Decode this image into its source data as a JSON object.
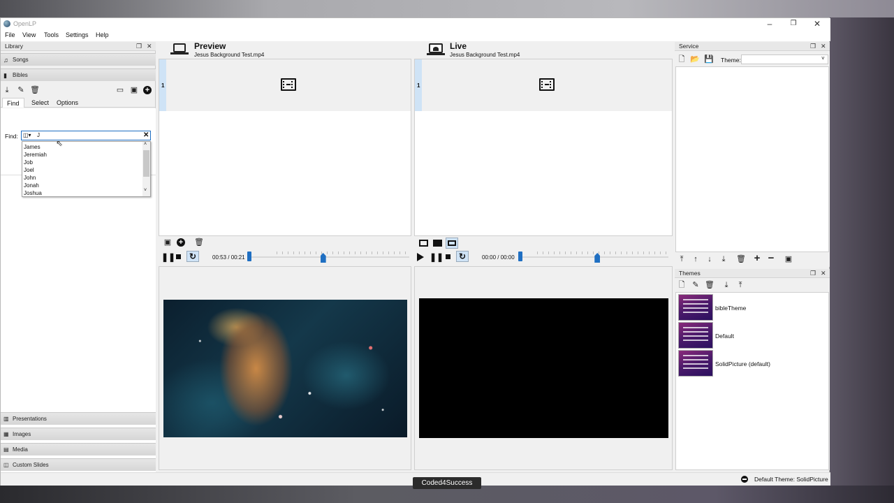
{
  "window": {
    "title": "OpenLP"
  },
  "menu": [
    "File",
    "View",
    "Tools",
    "Settings",
    "Help"
  ],
  "library": {
    "title": "Library",
    "items_top": [
      {
        "label": "Songs",
        "icon": "music-note-icon"
      },
      {
        "label": "Bibles",
        "icon": "book-icon"
      }
    ],
    "tabs": [
      "Find",
      "Select",
      "Options"
    ],
    "find_label": "Find:",
    "find_value": "J",
    "suggestions": [
      "James",
      "Jeremiah",
      "Job",
      "Joel",
      "John",
      "Jonah",
      "Joshua"
    ],
    "items_bottom": [
      {
        "label": "Presentations",
        "icon": "chart-icon"
      },
      {
        "label": "Images",
        "icon": "image-icon"
      },
      {
        "label": "Media",
        "icon": "media-icon"
      },
      {
        "label": "Custom Slides",
        "icon": "slides-icon"
      }
    ]
  },
  "preview": {
    "title": "Preview",
    "subtitle": "Jesus Background Test.mp4",
    "slide_number": "1",
    "time": "00:53 / 00:21",
    "progress": 0.0,
    "volume": 0.72
  },
  "live": {
    "title": "Live",
    "subtitle": "Jesus Background Test.mp4",
    "slide_number": "1",
    "time": "00:00 / 00:00",
    "progress": 0.0,
    "volume": 0.72
  },
  "service": {
    "title": "Service",
    "theme_label": "Theme:",
    "theme_value": ""
  },
  "themes": {
    "title": "Themes",
    "items": [
      "bibleTheme",
      "Default",
      "SolidPicture (default)"
    ]
  },
  "status": {
    "default_theme": "Default Theme: SolidPicture"
  },
  "watermark": "Coded4Success",
  "colors": {
    "accent": "#1f6fc2",
    "slide_selected": "#cfe3f6"
  }
}
